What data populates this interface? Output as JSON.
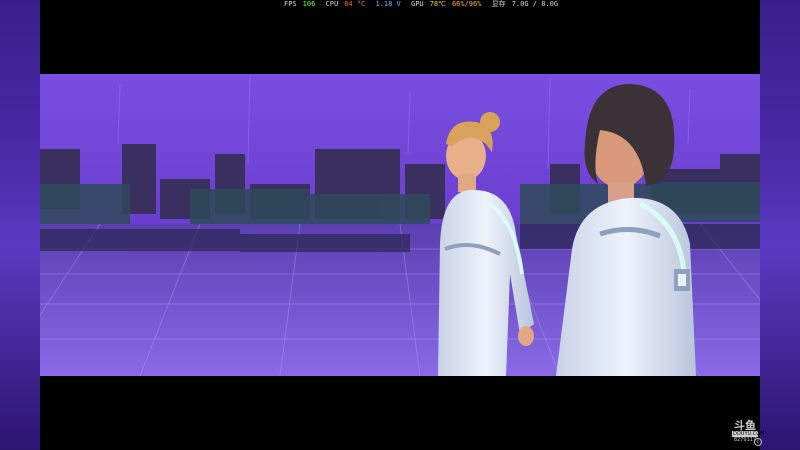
{
  "overlay": {
    "fps_label": "FPS",
    "fps_value": "106",
    "cpu_label": "CPU",
    "cpu_temp": "84 °C",
    "cpu_volt": "1.18 V",
    "gpu_label": "GPU",
    "gpu_temp": "78℃",
    "gpu_load": "66%/96%",
    "vram_label": "显存",
    "vram_value": "7.0G / 8.0G"
  },
  "watermark": {
    "logo": "斗鱼",
    "tag": "DOUYU.COM",
    "room_id": "8279117"
  },
  "colors": {
    "sky": "#6a3fd0",
    "floor": "#7a5ae0",
    "suit": "#e8eef8",
    "accent_glow": "#c8fff0"
  }
}
